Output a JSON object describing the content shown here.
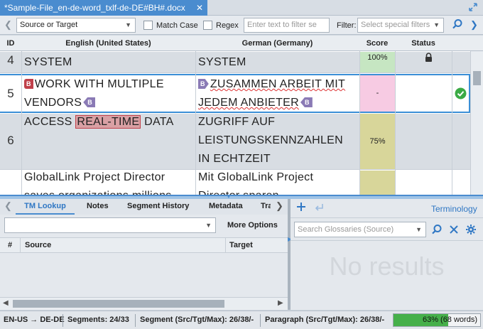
{
  "tab": {
    "title": "*Sample-File_en-de-word_txlf-de-DE#BH#.docx",
    "close": "✕"
  },
  "toolbar": {
    "scope_select": "Source or Target",
    "match_case": "Match Case",
    "regex": "Regex",
    "filter_text_placeholder": "Enter text to filter se",
    "filter_label": "Filter:",
    "special_filter_placeholder": "Select special filters"
  },
  "grid": {
    "headers": {
      "id": "ID",
      "source": "English (United States)",
      "target": "German (Germany)",
      "score": "Score",
      "status": "Status"
    },
    "rows": [
      {
        "id": "4",
        "source": "SYSTEM",
        "target": "SYSTEM",
        "score": "100%"
      },
      {
        "id": "5",
        "source_tag": "B",
        "source_a": "WORK WITH MULTIPLE",
        "source_b": "VENDORS",
        "target_tag": "B",
        "target_a": "ZUSAMMEN ARBEIT MIT",
        "target_b": "JEDEM ANBIETER",
        "score": "-"
      },
      {
        "id": "6",
        "source_pre": "ACCESS",
        "source_hl": "REAL-TIME",
        "source_post": "DATA",
        "target_a": "ZUGRIFF AUF",
        "target_b": "LEISTUNGSKENNZAHLEN",
        "target_c": "IN ECHTZEIT",
        "score": "75%"
      },
      {
        "id": "",
        "source_a": "GlobalLink Project Director",
        "source_b": "saves organizations millions",
        "target_a": "Mit GlobalLink Project",
        "target_b": "Director sparen",
        "score": ""
      }
    ]
  },
  "bottom_left": {
    "tabs": [
      "TM Lookup",
      "Notes",
      "Segment History",
      "Metadata",
      "Tra"
    ],
    "more_options": "More Options",
    "headers": {
      "num": "#",
      "source": "Source",
      "target": "Target"
    }
  },
  "bottom_right": {
    "terminology_label": "Terminology",
    "search_placeholder": "Search Glossaries (Source)",
    "no_results": "No results"
  },
  "status": {
    "lang": "EN-US → DE-DE",
    "segments": "Segments: 24/33",
    "segment_counts": "Segment (Src/Tgt/Max): 26/38/-",
    "paragraph_counts": "Paragraph (Src/Tgt/Max): 26/38/-",
    "progress_text": "63% (68 words)",
    "progress_fraction": 0.63
  },
  "colors": {
    "accent": "#4a8ccf",
    "score_100": "#c6e6c2",
    "score_dash": "#f7cbe3",
    "score_75": "#d8d69a",
    "confirm": "#3aaa45",
    "progress": "#46b04a"
  }
}
